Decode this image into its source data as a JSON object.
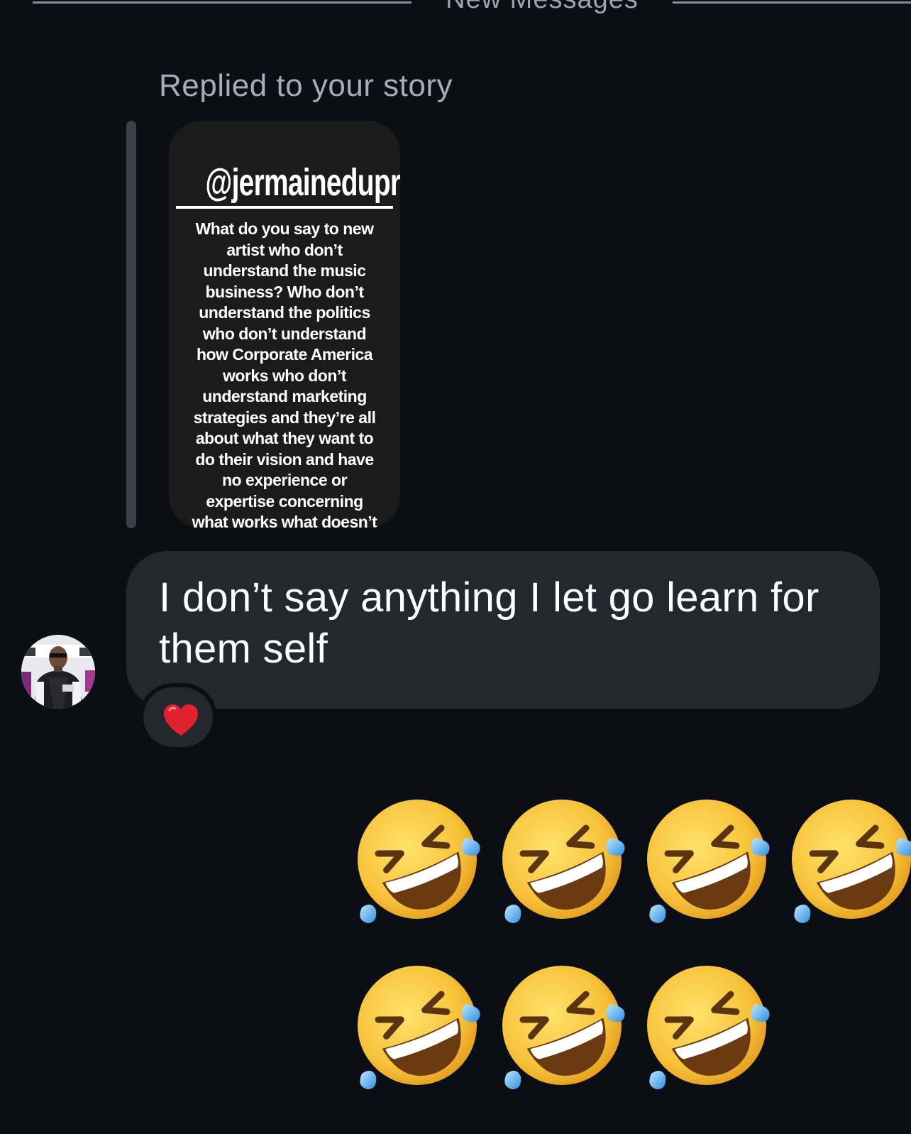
{
  "divider": {
    "label": "New Messages"
  },
  "reply": {
    "label": "Replied to your story"
  },
  "story": {
    "handle": "@jermainedupri",
    "text": "What do you say to new artist who don’t understand the music business? Who don’t understand the politics who don’t understand how Corporate America works who don’t understand marketing strategies and they’re all about what they want to do their vision and have no experience or expertise concerning what works what doesn’t works why it works and why it doesn’t work."
  },
  "message": {
    "text": "I don’t say anything I let go learn for them self",
    "reaction_icon": "red-heart-icon",
    "avatar_icon": "sender-avatar"
  },
  "reply_emojis": {
    "icon": "rolling-on-the-floor-laughing-emoji",
    "count": 7
  },
  "colors": {
    "background": "#0b0e14",
    "bubble": "#24272e",
    "story_card": "#1b1b1b",
    "heart": "#e0222e",
    "emoji_face": "#f7c23a"
  }
}
